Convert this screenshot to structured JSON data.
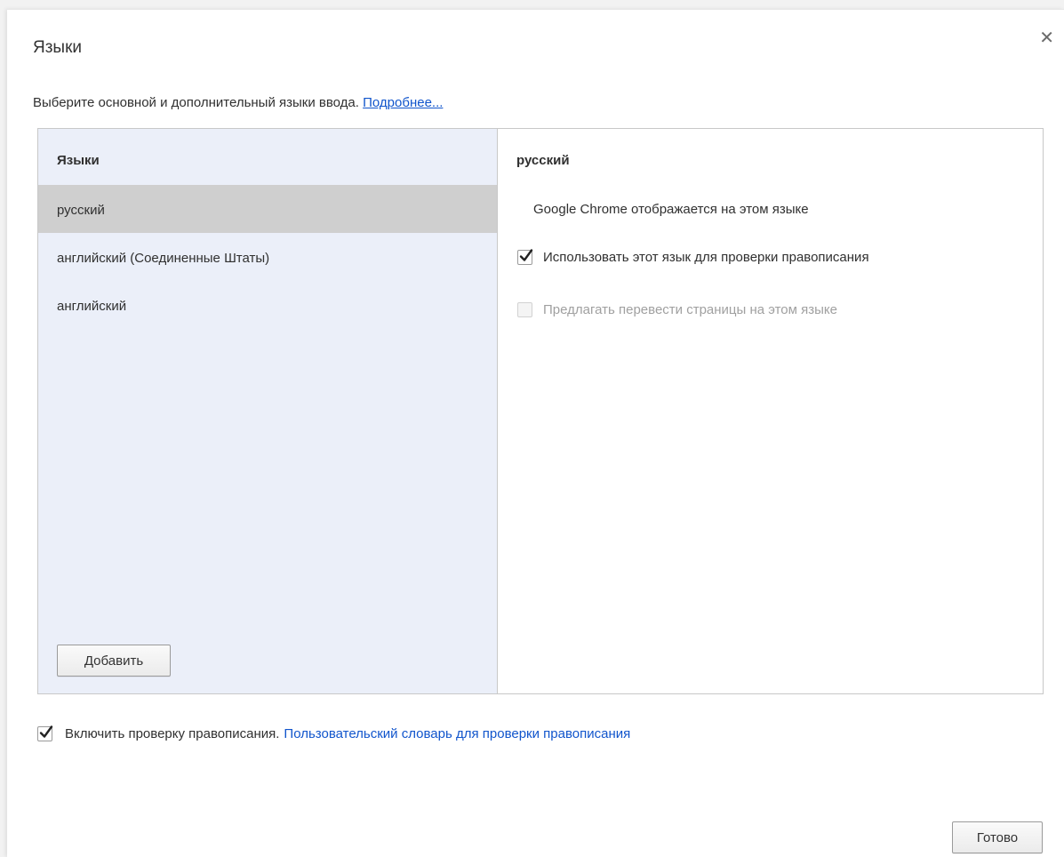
{
  "dialog": {
    "title": "Языки",
    "close_icon": "close-icon",
    "intro_text": "Выберите основной и дополнительный языки ввода.",
    "intro_link": "Подробнее..."
  },
  "languages": {
    "header": "Языки",
    "items": [
      {
        "label": "русский",
        "selected": true
      },
      {
        "label": "английский (Соединенные Штаты)",
        "selected": false
      },
      {
        "label": "английский",
        "selected": false
      }
    ],
    "add_label": "Добавить"
  },
  "details": {
    "header": "русский",
    "display_note": "Google Chrome отображается на этом языке",
    "spellcheck_label": "Использовать этот язык для проверки правописания",
    "spellcheck_checked": true,
    "translate_label": "Предлагать перевести страницы на этом языке",
    "translate_checked": false,
    "translate_disabled": true
  },
  "footer": {
    "enable_spellcheck_label": "Включить проверку правописания.",
    "enable_spellcheck_checked": true,
    "custom_dictionary_link": "Пользовательский словарь для проверки правописания",
    "done_label": "Готово"
  },
  "colors": {
    "link": "#1155cc",
    "left_panel_bg": "#ebeff9",
    "selected_row": "#cfcfcf"
  }
}
